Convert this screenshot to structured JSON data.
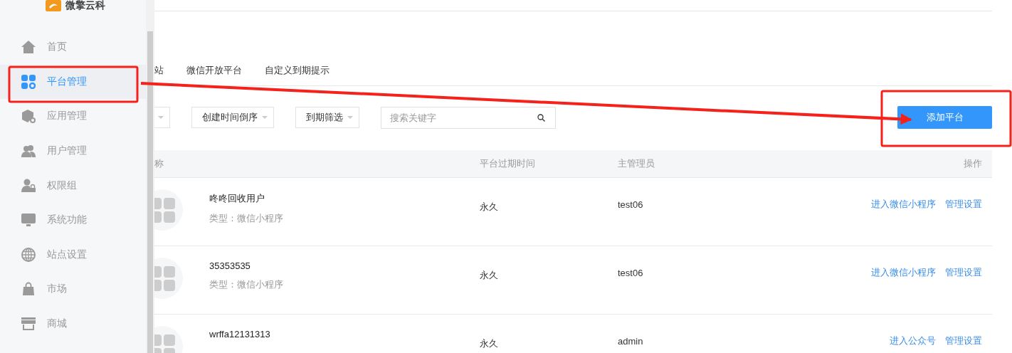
{
  "sidebar": {
    "logo_text": "微擎云科",
    "items": [
      {
        "label": "首页",
        "selected": false
      },
      {
        "label": "平台管理",
        "selected": true
      },
      {
        "label": "应用管理",
        "selected": false
      },
      {
        "label": "用户管理",
        "selected": false
      },
      {
        "label": "权限组",
        "selected": false
      },
      {
        "label": "系统功能",
        "selected": false
      },
      {
        "label": "站点设置",
        "selected": false
      },
      {
        "label": "市场",
        "selected": false
      },
      {
        "label": "商城",
        "selected": false
      }
    ]
  },
  "tabs": [
    {
      "label": "站"
    },
    {
      "label": "微信开放平台"
    },
    {
      "label": "自定义到期提示"
    }
  ],
  "filters": [
    {
      "label": "创建时间倒序"
    },
    {
      "label": "到期筛选"
    }
  ],
  "search": {
    "placeholder": "搜索关键字"
  },
  "add_button": "添加平台",
  "table": {
    "columns": [
      "称",
      "平台过期时间",
      "主管理员",
      "操作"
    ],
    "rows": [
      {
        "name": "咚咚回收用户",
        "type": "类型：微信小程序",
        "expiry": "永久",
        "admin": "test06",
        "actions": [
          "进入微信小程序",
          "管理设置"
        ]
      },
      {
        "name": "35353535",
        "type": "类型：微信小程序",
        "expiry": "永久",
        "admin": "test06",
        "actions": [
          "进入微信小程序",
          "管理设置"
        ]
      },
      {
        "name": "wrffa12131313",
        "expiry": "永久",
        "admin": "admin",
        "actions": [
          "进入公众号",
          "管理设置"
        ]
      }
    ]
  }
}
